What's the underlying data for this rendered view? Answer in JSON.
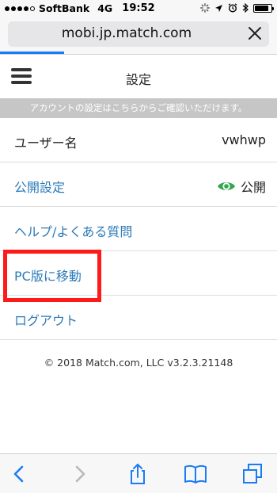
{
  "status_bar": {
    "carrier": "SoftBank",
    "network": "4G",
    "time": "19:52",
    "signal_bars_filled": 4,
    "signal_bars_total": 5,
    "battery_level": 0.85
  },
  "browser": {
    "url": "mobi.jp.match.com",
    "load_progress": 0.23
  },
  "header": {
    "title": "設定"
  },
  "banner": {
    "text": "アカウントの設定はこちらからご確認いただけます。"
  },
  "settings": {
    "username_label": "ユーザー名",
    "username_value": "vwhwp",
    "visibility_label": "公開設定",
    "visibility_value": "公開",
    "help_label": "ヘルプ/よくある質問",
    "pc_label": "PC版に移動",
    "logout_label": "ログアウト"
  },
  "footer": {
    "copyright": "© 2018 Match.com, LLC v3.2.3.21148"
  },
  "colors": {
    "link": "#2b7ab8",
    "eye_icon": "#2fa84f",
    "highlight": "#ff1a1a",
    "toolbar_icon": "#1a7cf5",
    "toolbar_icon_disabled": "#b8b8b8"
  }
}
